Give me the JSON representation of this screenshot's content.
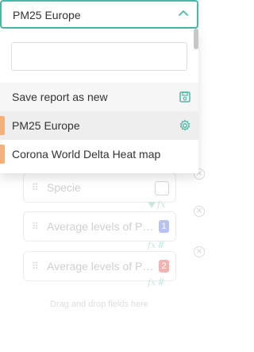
{
  "selector": {
    "selected_label": "PM25 Europe"
  },
  "menu": {
    "search_placeholder": "",
    "save_label": "Save report as new",
    "items": [
      {
        "label": "PM25 Europe",
        "active": true
      },
      {
        "label": "Corona World Delta Heat map",
        "active": false
      }
    ]
  },
  "fields": [
    {
      "label": "Specie"
    },
    {
      "label": "Average levels of PM25",
      "badge": "1"
    },
    {
      "label": "Average levels of PM25",
      "badge": "2"
    }
  ],
  "dropzone_text": "Drag and drop fields here",
  "colors": {
    "accent_teal": "#4db6a6",
    "item_marker": "#f4b07a",
    "badge_blue": "#b9c1ef",
    "badge_red": "#f2b3b3"
  }
}
